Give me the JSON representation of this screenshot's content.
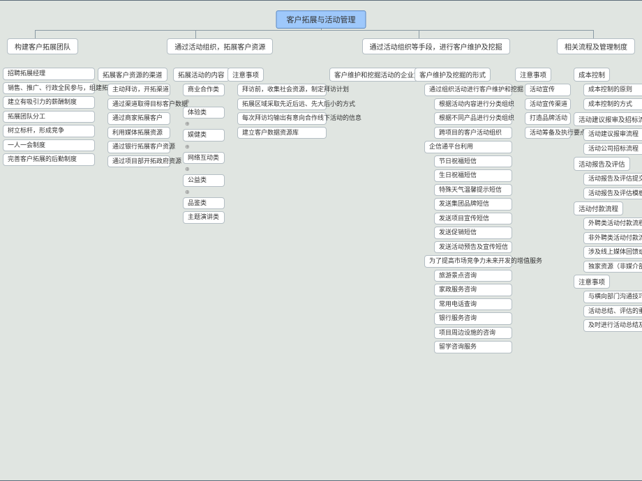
{
  "root": "客户拓展与活动管理",
  "main": [
    "构建客户拓展团队",
    "通过活动组织，拓展客户资源",
    "通过活动组织等手段，进行客户维护及挖掘",
    "相关流程及管理制度"
  ],
  "c1": [
    "招聘拓展经理",
    "销售、推广、行政全民参与，组建拓展团队",
    "建立有吸引力的薪酬制度",
    "拓展团队分工",
    "树立标杆，形成竞争",
    "一人一会制度",
    "完善客户拓展的后勤制度"
  ],
  "c2a_hdr": "拓展客户资源的渠道",
  "c2a": [
    "主动拜访，开拓渠道",
    "通过渠道取得目标客户数据",
    "通过商家拓展客户",
    "利用媒体拓展资源",
    "通过银行拓展客户资源",
    "通过项目部开拓政府资源"
  ],
  "c2b_hdr": "拓展活动的内容",
  "c2b": [
    "商业合作类",
    "体验类",
    "娱健类",
    "网络互动类",
    "公益类",
    "品鉴类",
    "主题演讲类"
  ],
  "c2c_hdr": "注意事项",
  "c2c": [
    "拜访前，收集社会资源，制定拜访计划",
    "拓展区域采取先近后远、先大后小的方式",
    "每次拜访均输出有意向合作线下活动的信息",
    "建立客户数据资源库"
  ],
  "c3a_hdr": "客户维护和挖掘活动的企业定义",
  "c3b_hdr": "客户维护及挖掘的形式",
  "c3b1": "通过组织活动进行客户维护和挖掘",
  "c3b1s": [
    "根据活动内容进行分类组织",
    "根据不同产品进行分类组织",
    "跨项目的客户活动组织"
  ],
  "c3b2": "企信通平台利用",
  "c3b2s": [
    "节日祝福短信",
    "生日祝福短信",
    "特殊天气温馨提示短信",
    "发送集团品牌短信",
    "发送项目宣传短信",
    "发送促销短信",
    "发送活动预告及宣传短信"
  ],
  "c3b3": "为了提高市场竞争力未来开发的增值服务",
  "c3b3s": [
    "旅游景点咨询",
    "家政服务咨询",
    "常用电话查询",
    "银行服务咨询",
    "项目周边设施的咨询",
    "留学咨询服务"
  ],
  "c3c_hdr": "注意事项",
  "c3c": [
    "活动宣传",
    "活动宣传渠道",
    "打造品牌活动",
    "活动筹备及执行要点"
  ],
  "c4a_hdr": "成本控制",
  "c4a": [
    "成本控制的原则",
    "成本控制的方式"
  ],
  "c4b_hdr": "活动建议报审及招标流程",
  "c4b": [
    "活动建议报审流程",
    "活动公司招标流程"
  ],
  "c4c_hdr": "活动报告及评估",
  "c4c": [
    "活动报告及评估提交要求",
    "活动报告及评估模板"
  ],
  "c4d_hdr": "活动付款流程",
  "c4d": [
    "外聘类活动付款流程",
    "非外聘类活动付款流程",
    "涉及线上媒体回馈或赞助类活动付款流程",
    "独家资源（非媒介部执行）付款流程"
  ],
  "c4e_hdr": "注意事项",
  "c4e": [
    "与横向部门沟通技巧",
    "活动总结、评估的重要性",
    "及时进行活动总结及费用报销"
  ]
}
